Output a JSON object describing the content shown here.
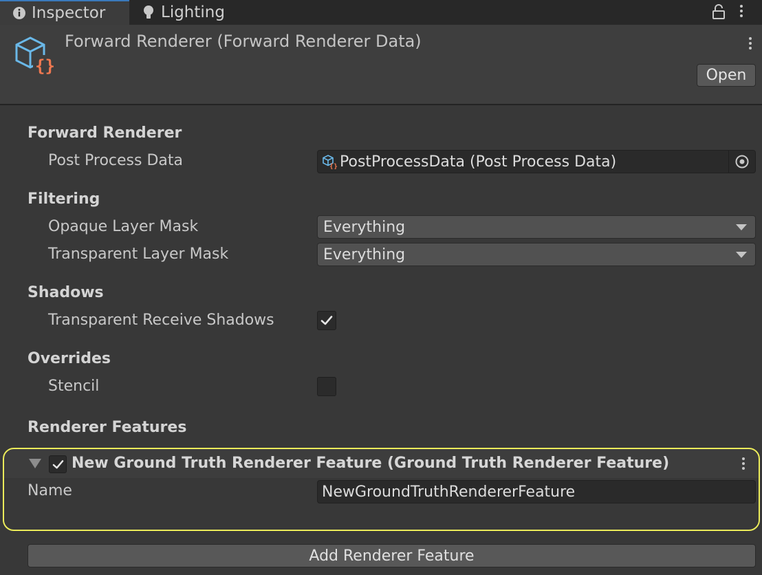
{
  "tabs": [
    {
      "label": "Inspector",
      "icon": "info-icon",
      "active": true
    },
    {
      "label": "Lighting",
      "icon": "lightbulb-icon",
      "active": false
    }
  ],
  "header": {
    "title": "Forward Renderer (Forward Renderer Data)",
    "icon": "scriptable-object-icon",
    "open_label": "Open"
  },
  "sections": {
    "forward_renderer": {
      "title": "Forward Renderer",
      "post_process_label": "Post Process Data",
      "post_process_value": "PostProcessData (Post Process Data)"
    },
    "filtering": {
      "title": "Filtering",
      "opaque_label": "Opaque Layer Mask",
      "opaque_value": "Everything",
      "transparent_label": "Transparent Layer Mask",
      "transparent_value": "Everything"
    },
    "shadows": {
      "title": "Shadows",
      "receive_label": "Transparent Receive Shadows",
      "receive_checked": true
    },
    "overrides": {
      "title": "Overrides",
      "stencil_label": "Stencil",
      "stencil_checked": false
    },
    "renderer_features": {
      "title": "Renderer Features",
      "feature": {
        "title": "New Ground Truth Renderer Feature (Ground Truth Renderer Feature)",
        "enabled": true,
        "name_label": "Name",
        "name_value": "NewGroundTruthRendererFeature"
      },
      "add_label": "Add Renderer Feature"
    }
  },
  "colors": {
    "highlight": "#ecec5a",
    "accent_blue": "#6ab8e8",
    "accent_orange": "#f07850"
  }
}
